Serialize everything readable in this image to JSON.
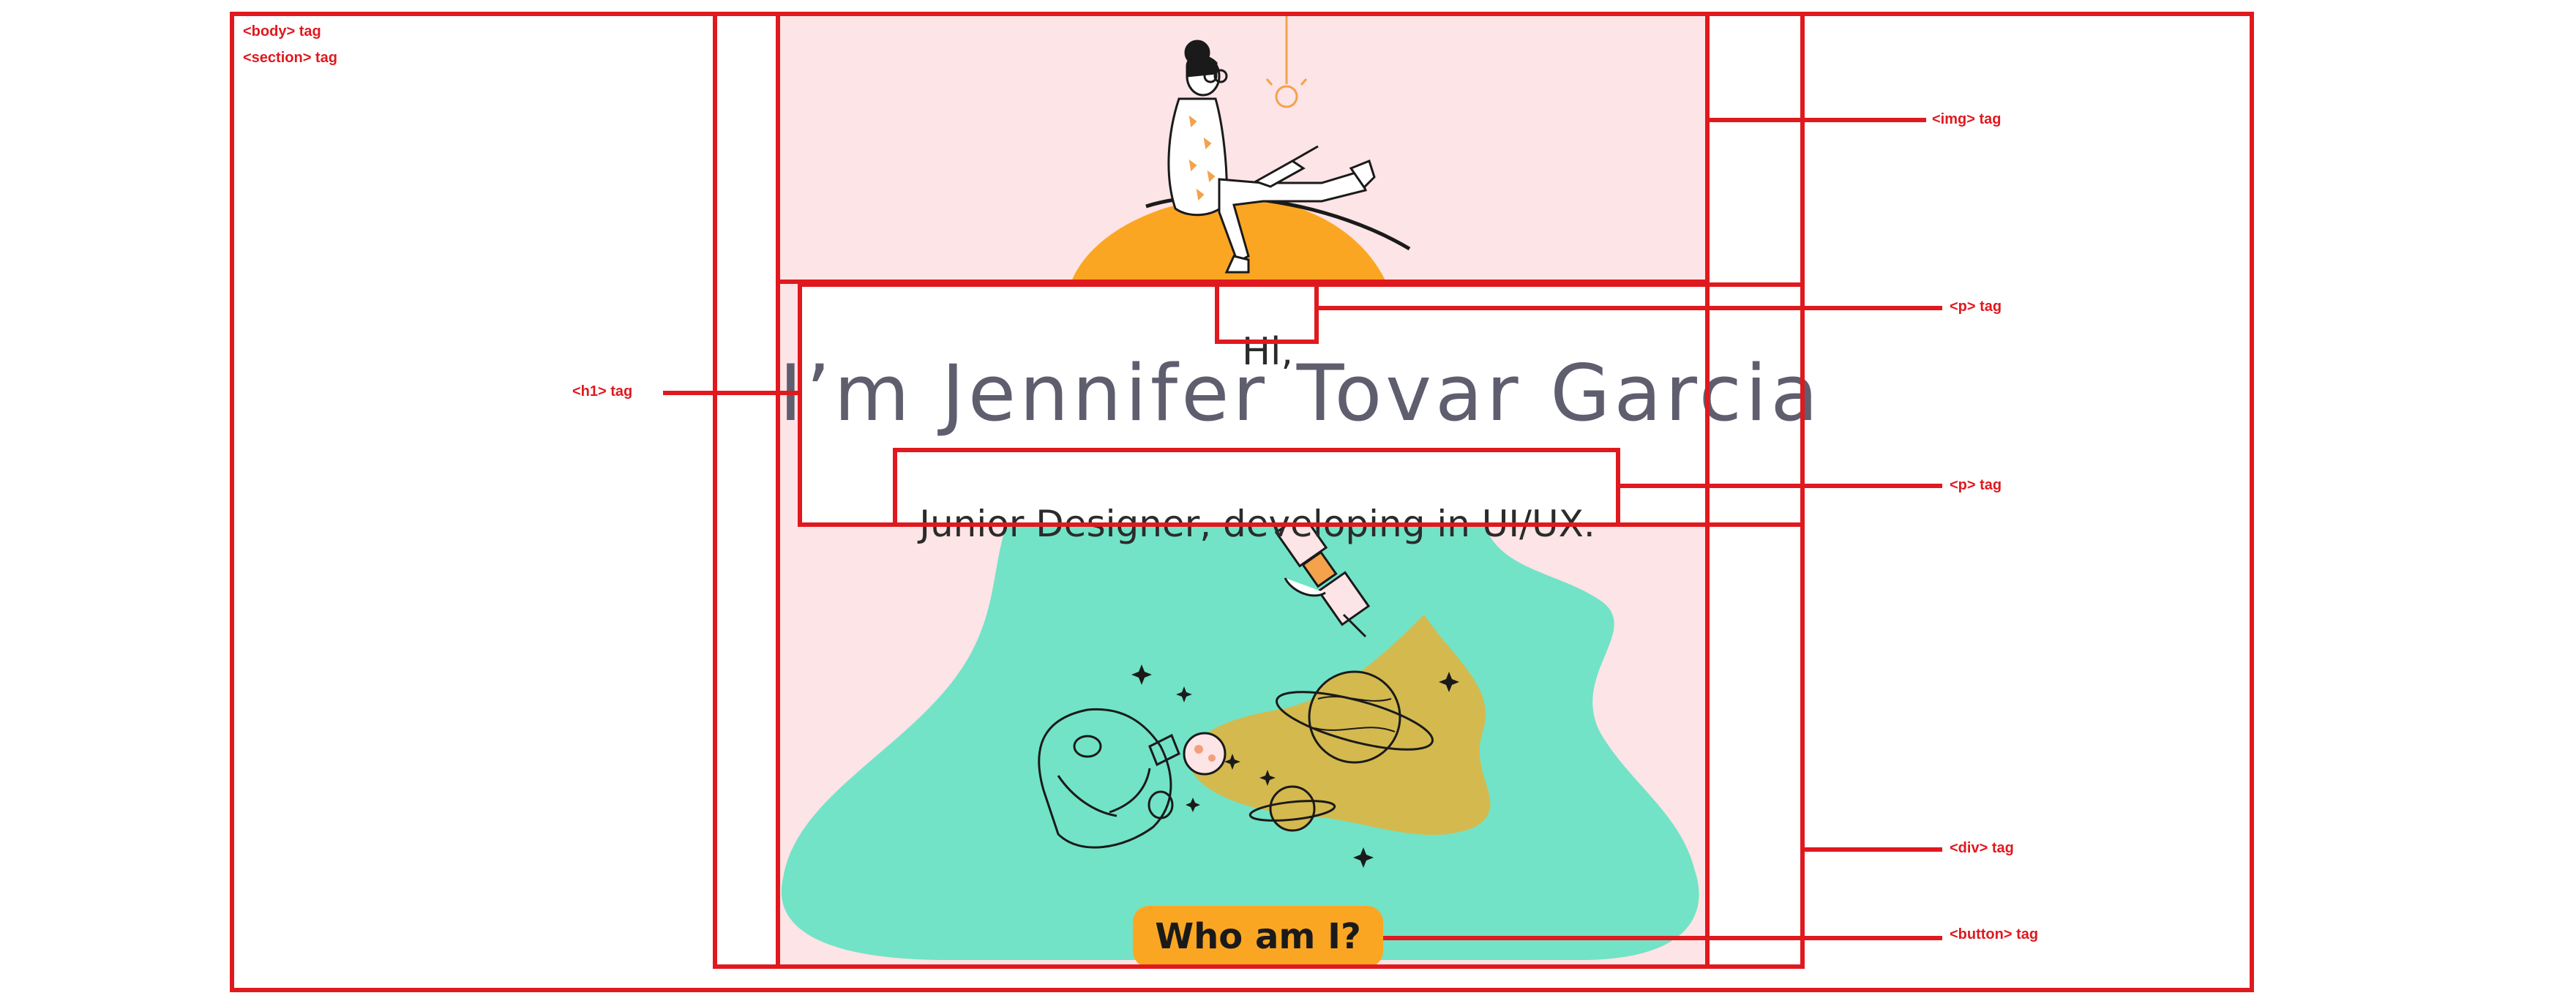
{
  "hero": {
    "greeting": "Hi,",
    "heading": "I’m Jennifer Tovar Garcia",
    "subtitle": "Junior Designer, developing in UI/UX.",
    "button_label": "Who am I?"
  },
  "annotations": {
    "body_tag": "<body> tag",
    "section_tag": "<section> tag",
    "h1_tag": "<h1> tag",
    "img_tag": "<img> tag",
    "p_tag_greeting": "<p> tag",
    "p_tag_subtitle": "<p> tag",
    "div_tag": "<div> tag",
    "button_tag": "<button> tag"
  },
  "colors": {
    "annotation": "#e0191e",
    "page_background": "#fde4e6",
    "planet_orange": "#fba623",
    "mint_blob": "#72e3c6",
    "space_gold": "#d4b94e",
    "heading_text": "#5e5e6e",
    "button_bg": "#fba623"
  },
  "illustrations": {
    "top": "woman-on-planet-with-laptop",
    "bottom": "astronaut-with-satellite-and-planets"
  }
}
